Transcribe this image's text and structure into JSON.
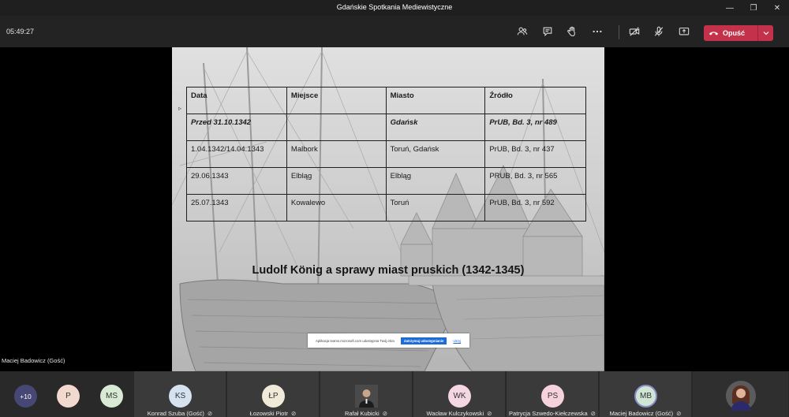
{
  "window": {
    "title": "Gdańskie Spotkania Mediewistyczne"
  },
  "toolbar": {
    "timer": "05:49:27",
    "leave_label": "Opuść"
  },
  "slide": {
    "table": {
      "headers": [
        "Data",
        "Miejsce",
        "Miasto",
        "Źródło"
      ],
      "rows": [
        [
          "Przed 31.10.1342",
          "",
          "Gdańsk",
          "PrUB, Bd. 3, nr 489"
        ],
        [
          "1.04.1342/14.04.1343",
          "Malbork",
          "Toruń, Gdańsk",
          "PrUB, Bd. 3, nr 437"
        ],
        [
          "29.06.1343",
          "Elbląg",
          "Elbląg",
          "PRUB, Bd. 3, nr 565"
        ],
        [
          "25.07.1343",
          "Kowalewo",
          "Toruń",
          "PrUB, Bd. 3, nr 592"
        ]
      ]
    },
    "title": "Ludolf König a sprawy miast pruskich (1342-1345)",
    "sharebar": {
      "text": "Aplikacja teams.microsoft.com udostępnia Twój ekran.",
      "stop_label": "Zatrzymaj udostępnianie",
      "hide_label": "Ukryj"
    }
  },
  "presenter_name": "Maciej Badowicz (Gość)",
  "tray": {
    "overflow_count": "+10",
    "avatars": [
      {
        "initials": "P",
        "color": "#f2d9d0"
      },
      {
        "initials": "MS",
        "color": "#d8ead4"
      }
    ],
    "participants": [
      {
        "initials": "KS",
        "name": "Konrad Szuba (Gość)",
        "color": "#d4e3ef"
      },
      {
        "initials": "ŁP",
        "name": "Łozowski Piotr",
        "color": "#f0ebd8"
      },
      {
        "initials": "",
        "name": "Rafał Kubicki",
        "color": "#555555"
      },
      {
        "initials": "WK",
        "name": "Wacław Kulczykowski",
        "color": "#f5d6e3"
      },
      {
        "initials": "PS",
        "name": "Patrycja Szwedo-Kiełczewska",
        "color": "#f5d2dc"
      },
      {
        "initials": "MB",
        "name": "Maciej Badowicz (Gość)",
        "color": "#cfe6d4"
      }
    ]
  },
  "colors": {
    "leave": "#c4314b",
    "speaking_ring": "#8b8cc7"
  }
}
